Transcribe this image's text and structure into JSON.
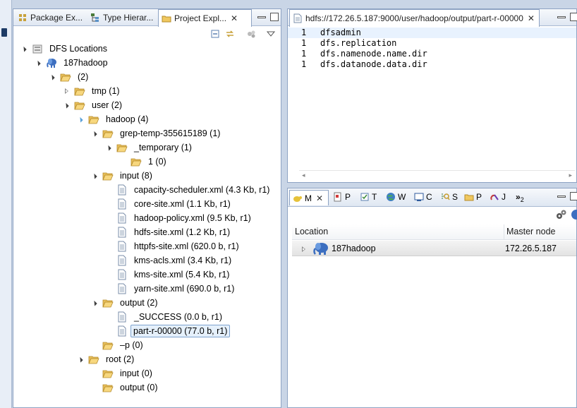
{
  "left_pane": {
    "tabs": [
      {
        "label": "Package Ex...",
        "icon": "package-explorer-icon"
      },
      {
        "label": "Type Hierar...",
        "icon": "type-hierarchy-icon"
      },
      {
        "label": "Project Expl...",
        "icon": "project-explorer-icon",
        "active": true
      }
    ],
    "tree": [
      {
        "label": "DFS Locations",
        "depth": 0,
        "icon": "dfs-locations-icon",
        "state": "open"
      },
      {
        "label": "187hadoop",
        "depth": 1,
        "icon": "hadoop-elephant-icon",
        "state": "open"
      },
      {
        "label": "(2)",
        "depth": 2,
        "icon": "folder-open-icon",
        "state": "open"
      },
      {
        "label": "tmp (1)",
        "depth": 3,
        "icon": "folder-open-icon",
        "state": "closed"
      },
      {
        "label": "user (2)",
        "depth": 3,
        "icon": "folder-open-icon",
        "state": "open"
      },
      {
        "label": "hadoop (4)",
        "depth": 4,
        "icon": "folder-open-icon",
        "state": "open-blue"
      },
      {
        "label": "grep-temp-355615189 (1)",
        "depth": 5,
        "icon": "folder-open-icon",
        "state": "open"
      },
      {
        "label": "_temporary (1)",
        "depth": 6,
        "icon": "folder-open-icon",
        "state": "open"
      },
      {
        "label": "1 (0)",
        "depth": 7,
        "icon": "folder-open-icon",
        "state": "none"
      },
      {
        "label": "input (8)",
        "depth": 5,
        "icon": "folder-open-icon",
        "state": "open"
      },
      {
        "label": "capacity-scheduler.xml (4.3 Kb, r1)",
        "depth": 6,
        "icon": "file-icon",
        "state": "none"
      },
      {
        "label": "core-site.xml (1.1 Kb, r1)",
        "depth": 6,
        "icon": "file-icon",
        "state": "none"
      },
      {
        "label": "hadoop-policy.xml (9.5 Kb, r1)",
        "depth": 6,
        "icon": "file-icon",
        "state": "none"
      },
      {
        "label": "hdfs-site.xml (1.2 Kb, r1)",
        "depth": 6,
        "icon": "file-icon",
        "state": "none"
      },
      {
        "label": "httpfs-site.xml (620.0 b, r1)",
        "depth": 6,
        "icon": "file-icon",
        "state": "none"
      },
      {
        "label": "kms-acls.xml (3.4 Kb, r1)",
        "depth": 6,
        "icon": "file-icon",
        "state": "none"
      },
      {
        "label": "kms-site.xml (5.4 Kb, r1)",
        "depth": 6,
        "icon": "file-icon",
        "state": "none"
      },
      {
        "label": "yarn-site.xml (690.0 b, r1)",
        "depth": 6,
        "icon": "file-icon",
        "state": "none"
      },
      {
        "label": "output (2)",
        "depth": 5,
        "icon": "folder-open-icon",
        "state": "open"
      },
      {
        "label": "_SUCCESS (0.0 b, r1)",
        "depth": 6,
        "icon": "file-icon",
        "state": "none"
      },
      {
        "label": "part-r-00000 (77.0 b, r1)",
        "depth": 6,
        "icon": "file-icon",
        "state": "none",
        "selected": true
      },
      {
        "label": "–p (0)",
        "depth": 5,
        "icon": "folder-open-icon",
        "state": "none"
      },
      {
        "label": "root (2)",
        "depth": 4,
        "icon": "folder-open-icon",
        "state": "open"
      },
      {
        "label": "input (0)",
        "depth": 5,
        "icon": "folder-open-icon",
        "state": "none"
      },
      {
        "label": "output (0)",
        "depth": 5,
        "icon": "folder-open-icon",
        "state": "none"
      }
    ]
  },
  "editor": {
    "tab_title": "hdfs://172.26.5.187:9000/user/hadoop/output/part-r-00000",
    "lines": [
      {
        "num": "1",
        "text": "dfsadmin"
      },
      {
        "num": "1",
        "text": "dfs.replication"
      },
      {
        "num": "1",
        "text": "dfs.namenode.name.dir"
      },
      {
        "num": "1",
        "text": "dfs.datanode.data.dir"
      }
    ]
  },
  "locations": {
    "tabs": [
      {
        "label": "M",
        "icon": "mapreduce-locations-icon",
        "active": true
      },
      {
        "label": "P",
        "icon": "problems-icon"
      },
      {
        "label": "T",
        "icon": "tasks-icon"
      },
      {
        "label": "W",
        "icon": "web-browser-icon"
      },
      {
        "label": "C",
        "icon": "console-icon"
      },
      {
        "label": "S",
        "icon": "search-icon"
      },
      {
        "label": "P",
        "icon": "progress-icon"
      },
      {
        "label": "J",
        "icon": "junit-icon"
      },
      {
        "label": "»",
        "icon": "overflow-chevron-icon"
      }
    ],
    "overflow_count": "2",
    "columns": {
      "location": "Location",
      "master": "Master node"
    },
    "rows": [
      {
        "location": "187hadoop",
        "master": "172.26.5.187"
      }
    ]
  }
}
